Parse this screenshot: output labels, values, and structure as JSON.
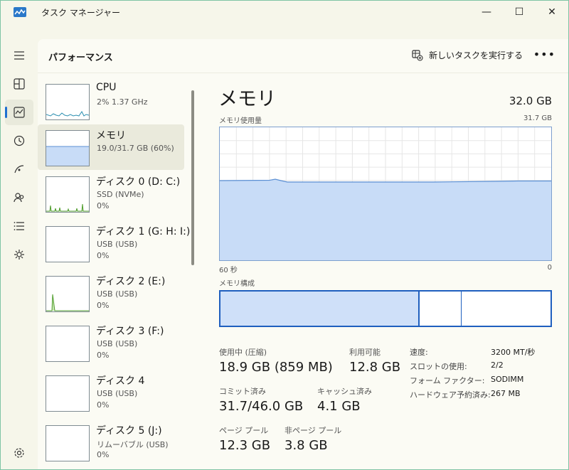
{
  "window": {
    "title": "タスク マネージャー",
    "minimize": "—",
    "maximize": "☐",
    "close": "✕"
  },
  "header": {
    "title": "パフォーマンス",
    "run_task": "新しいタスクを実行する",
    "more": "•••"
  },
  "rail": {
    "items": [
      {
        "icon": "hamburger-icon"
      },
      {
        "icon": "processes-icon"
      },
      {
        "icon": "performance-icon",
        "active": true
      },
      {
        "icon": "app-history-icon"
      },
      {
        "icon": "startup-apps-icon"
      },
      {
        "icon": "users-icon"
      },
      {
        "icon": "details-icon"
      },
      {
        "icon": "services-icon"
      },
      {
        "icon": "settings-icon"
      }
    ]
  },
  "devices": [
    {
      "name": "CPU",
      "sub": "2%  1.37 GHz",
      "value": ""
    },
    {
      "name": "メモリ",
      "sub": "19.0/31.7 GB (60%)",
      "value": "",
      "active": true
    },
    {
      "name": "ディスク 0 (D: C:)",
      "sub": "SSD (NVMe)",
      "value": "0%"
    },
    {
      "name": "ディスク 1 (G: H: I:)",
      "sub": "USB (USB)",
      "value": "0%"
    },
    {
      "name": "ディスク 2 (E:)",
      "sub": "USB (USB)",
      "value": "0%"
    },
    {
      "name": "ディスク 3 (F:)",
      "sub": "USB (USB)",
      "value": "0%"
    },
    {
      "name": "ディスク 4",
      "sub": "USB (USB)",
      "value": "0%"
    },
    {
      "name": "ディスク 5 (J:)",
      "sub": "リムーバブル (USB)",
      "value": "0%"
    }
  ],
  "memory": {
    "title": "メモリ",
    "total": "32.0 GB",
    "usage_label": "メモリ使用量",
    "usage_max": "31.7 GB",
    "x_left": "60 秒",
    "x_right": "0",
    "composition_label": "メモリ構成",
    "stats": {
      "in_use_label": "使用中 (圧縮)",
      "in_use": "18.9 GB (859 MB)",
      "available_label": "利用可能",
      "available": "12.8 GB",
      "committed_label": "コミット済み",
      "committed": "31.7/46.0 GB",
      "cached_label": "キャッシュ済み",
      "cached": "4.1 GB",
      "paged_label": "ページ プール",
      "paged": "12.3 GB",
      "nonpaged_label": "非ページ プール",
      "nonpaged": "3.8 GB"
    },
    "specs": [
      {
        "k": "速度:",
        "v": "3200 MT/秒"
      },
      {
        "k": "スロットの使用:",
        "v": "2/2"
      },
      {
        "k": "フォーム ファクター:",
        "v": "SODIMM"
      },
      {
        "k": "ハードウェア予約済み:",
        "v": "267 MB"
      }
    ]
  },
  "colors": {
    "accent": "#1e6fd0",
    "memory_fill": "#c8dcf7",
    "memory_line": "#5b8fd3",
    "disk_line": "#4f9d2c",
    "cpu_line": "#2b8fb0"
  }
}
